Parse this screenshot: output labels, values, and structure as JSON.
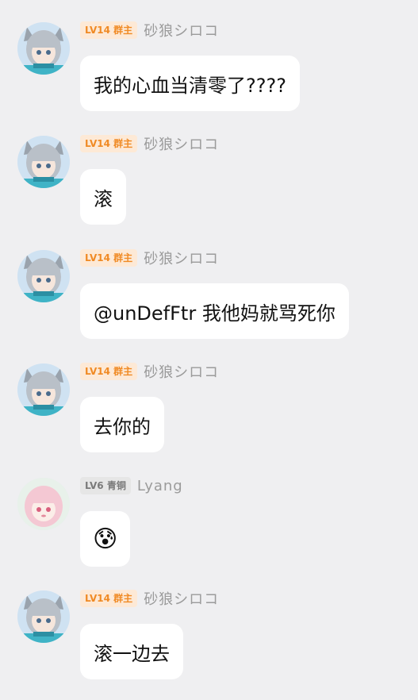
{
  "messages": [
    {
      "level": "LV14",
      "title": "群主",
      "nick": "砂狼シロコ",
      "text": "我的心血当清零了????",
      "avatar": "shiroko-avatar"
    },
    {
      "level": "LV14",
      "title": "群主",
      "nick": "砂狼シロコ",
      "text": "滚",
      "avatar": "shiroko-avatar"
    },
    {
      "level": "LV14",
      "title": "群主",
      "nick": "砂狼シロコ",
      "text": "@unDefFtr 我他妈就骂死你",
      "avatar": "shiroko-avatar"
    },
    {
      "level": "LV14",
      "title": "群主",
      "nick": "砂狼シロコ",
      "text": "去你的",
      "avatar": "shiroko-avatar"
    },
    {
      "level": "LV6",
      "title": "青铜",
      "nick": "Lyang",
      "text": "😰",
      "avatar": "lyang-avatar"
    },
    {
      "level": "LV14",
      "title": "群主",
      "nick": "砂狼シロコ",
      "text": "滚一边去",
      "avatar": "shiroko-avatar"
    }
  ],
  "colors": {
    "background": "#efeff1",
    "owner_badge_bg": "#fde9d6",
    "owner_badge_text": "#f08a24",
    "bronze_badge_bg": "#e6e6e6",
    "bronze_badge_text": "#7a7a7a"
  }
}
